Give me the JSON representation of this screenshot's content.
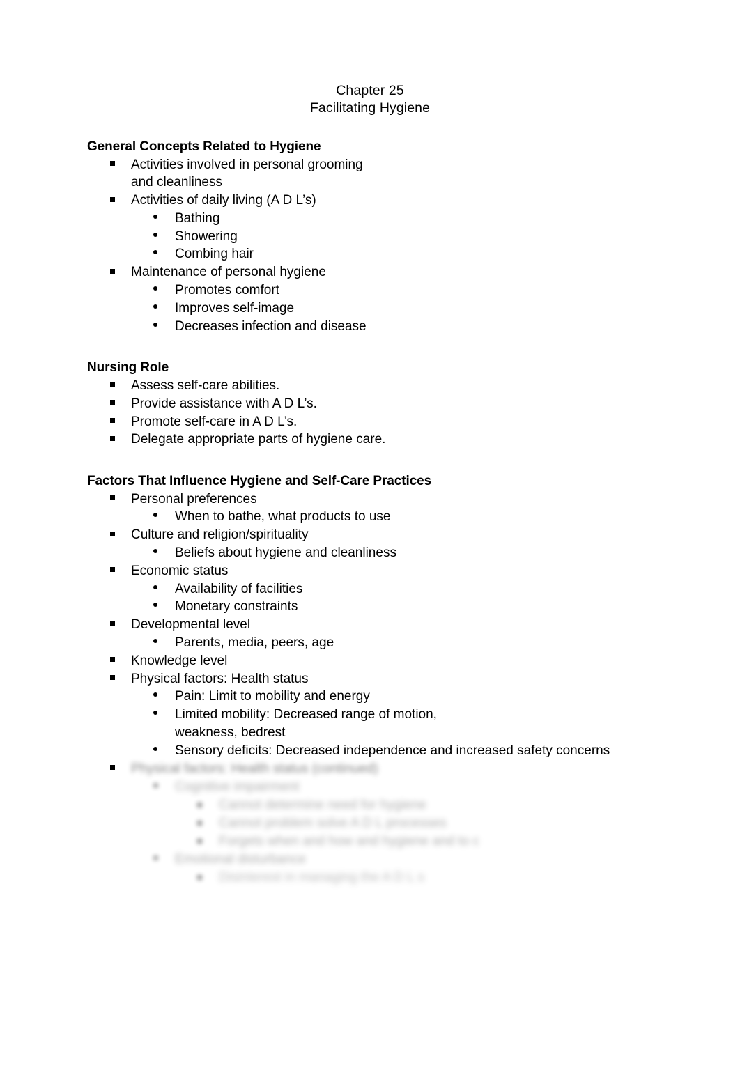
{
  "document": {
    "title_lines": [
      "Chapter 25",
      "Facilitating Hygiene"
    ],
    "background_color": "#ffffff",
    "text_color": "#000000"
  },
  "sections": [
    {
      "heading": "General Concepts Related to Hygiene",
      "items": [
        {
          "text": "Activities involved in personal grooming and cleanliness",
          "children": []
        },
        {
          "text": "Activities of daily living (A D L’s)",
          "children": [
            "Bathing",
            "Showering",
            "Combing hair"
          ]
        },
        {
          "text": "Maintenance of personal hygiene",
          "children": [
            "Promotes comfort",
            "Improves self-image",
            "Decreases infection and disease"
          ]
        }
      ]
    },
    {
      "heading": "Nursing Role",
      "items": [
        {
          "text": "Assess self-care abilities.",
          "children": []
        },
        {
          "text": "Provide assistance with A D L’s.",
          "children": []
        },
        {
          "text": "Promote self-care in A D L’s.",
          "children": []
        },
        {
          "text": "Delegate appropriate parts of hygiene care.",
          "children": []
        }
      ]
    },
    {
      "heading": "Factors That Influence Hygiene and Self-Care Practices",
      "items": [
        {
          "text": "Personal preferences",
          "children": [
            "When to bathe, what products to use"
          ]
        },
        {
          "text": "Culture and religion/spirituality",
          "children": [
            "Beliefs about hygiene and cleanliness"
          ]
        },
        {
          "text": "Economic status",
          "children": [
            "Availability of facilities",
            "Monetary constraints"
          ]
        },
        {
          "text": "Developmental level",
          "children": [
            "Parents, media, peers, age"
          ]
        },
        {
          "text": "Knowledge level",
          "children": []
        },
        {
          "text": "Physical factors: Health status",
          "children": [
            "Pain: Limit to mobility and energy",
            "Limited mobility: Decreased range of motion, weakness, bedrest",
            "Sensory deficits: Decreased independence and increased safety concerns"
          ]
        }
      ]
    }
  ],
  "obscured_block": {
    "note": "Lower portion of page is blurred/illegible",
    "lines": [
      {
        "level": 1,
        "placeholder": "Physical factors: Health status (continued)"
      },
      {
        "level": 2,
        "placeholder": "Cognitive impairment"
      },
      {
        "level": 3,
        "placeholder": "Cannot determine need for hygiene"
      },
      {
        "level": 3,
        "placeholder": "Cannot problem solve A D L processes"
      },
      {
        "level": 3,
        "placeholder": "Forgets when and how and hygiene and to c"
      },
      {
        "level": 2,
        "placeholder": "Emotional disturbance"
      },
      {
        "level": 3,
        "placeholder": "Disinterest in managing the A D L s"
      }
    ]
  }
}
